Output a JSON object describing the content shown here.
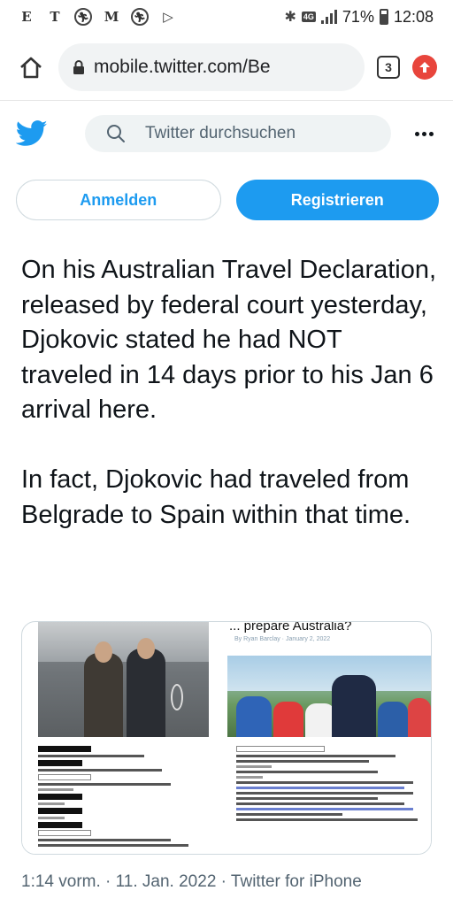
{
  "statusbar": {
    "left_icons": [
      "E",
      "T",
      "M"
    ],
    "network": "4G",
    "battery_percent": "71%",
    "time": "12:08"
  },
  "browser": {
    "url": "mobile.twitter.com/Be",
    "tab_count": "3"
  },
  "twitter": {
    "search_placeholder": "Twitter durchsuchen",
    "login_label": "Anmelden",
    "signup_label": "Registrieren"
  },
  "tweet": {
    "paragraphs": [
      "On his Australian Travel Declaration, released by federal court yesterday, Djokovic stated he had NOT traveled in 14 days prior to his Jan 6 arrival here.",
      "In fact, Djokovic had traveled from Belgrade to Spain within that time."
    ],
    "media": {
      "article_title": "... prepare Australia?",
      "article_byline": "By Ryan Barclay · January 2, 2022"
    },
    "timestamp": "1:14 vorm. · 11. Jan. 2022 · Twitter for iPhone"
  },
  "colors": {
    "twitter_blue": "#1d9bf0",
    "text_primary": "#0f1419",
    "text_secondary": "#536471",
    "update_red": "#e8453c"
  }
}
